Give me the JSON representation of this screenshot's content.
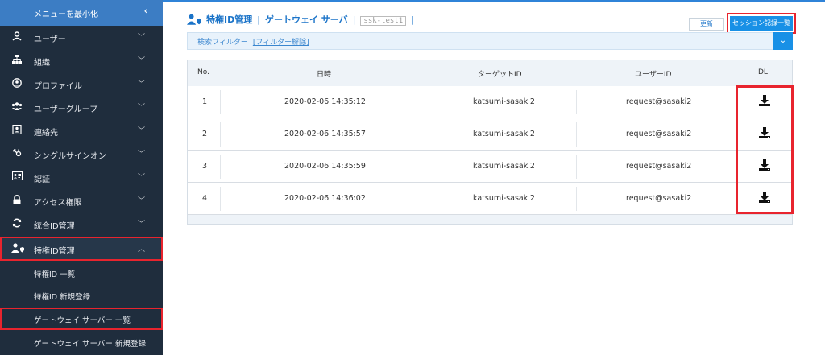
{
  "sidebar": {
    "minimize_label": "メニューを最小化",
    "minimize_icon": "chevron-left-icon",
    "items": [
      {
        "label": "ユーザー",
        "icon": "user-icon"
      },
      {
        "label": "組織",
        "icon": "org-chart-icon"
      },
      {
        "label": "プロファイル",
        "icon": "profile-icon"
      },
      {
        "label": "ユーザーグループ",
        "icon": "users-group-icon"
      },
      {
        "label": "連絡先",
        "icon": "contact-icon"
      },
      {
        "label": "シングルサインオン",
        "icon": "sso-icon"
      },
      {
        "label": "認証",
        "icon": "id-card-icon"
      },
      {
        "label": "アクセス権限",
        "icon": "lock-icon"
      },
      {
        "label": "統合ID管理",
        "icon": "sync-icon"
      },
      {
        "label": "特権ID管理",
        "icon": "user-shield-icon"
      }
    ],
    "subitems": [
      {
        "label": "特権ID 一覧"
      },
      {
        "label": "特権ID 新規登録"
      },
      {
        "label": "ゲートウェイ サーバー 一覧"
      },
      {
        "label": "ゲートウェイ サーバー 新規登録"
      }
    ]
  },
  "header": {
    "title": "特権ID管理",
    "subtitle": "ゲートウェイ サーバ",
    "separator": "|",
    "tag": "ssk-test1",
    "refresh_label": "更新",
    "session_label": "セッション記録一覧"
  },
  "filter": {
    "label": "検索フィルター",
    "clear_label": "[フィルター解除]"
  },
  "table": {
    "headers": {
      "no": "No.",
      "datetime": "日時",
      "target": "ターゲットID",
      "user": "ユーザーID",
      "dl": "DL"
    },
    "rows": [
      {
        "no": "1",
        "datetime": "2020-02-06 14:35:12",
        "target": "katsumi-sasaki2",
        "user": "request@sasaki2"
      },
      {
        "no": "2",
        "datetime": "2020-02-06 14:35:57",
        "target": "katsumi-sasaki2",
        "user": "request@sasaki2"
      },
      {
        "no": "3",
        "datetime": "2020-02-06 14:35:59",
        "target": "katsumi-sasaki2",
        "user": "request@sasaki2"
      },
      {
        "no": "4",
        "datetime": "2020-02-06 14:36:02",
        "target": "katsumi-sasaki2",
        "user": "request@sasaki2"
      }
    ]
  },
  "colors": {
    "accent": "#1890e6",
    "highlight": "#e8242e",
    "sidebar": "#1f2d3d"
  }
}
